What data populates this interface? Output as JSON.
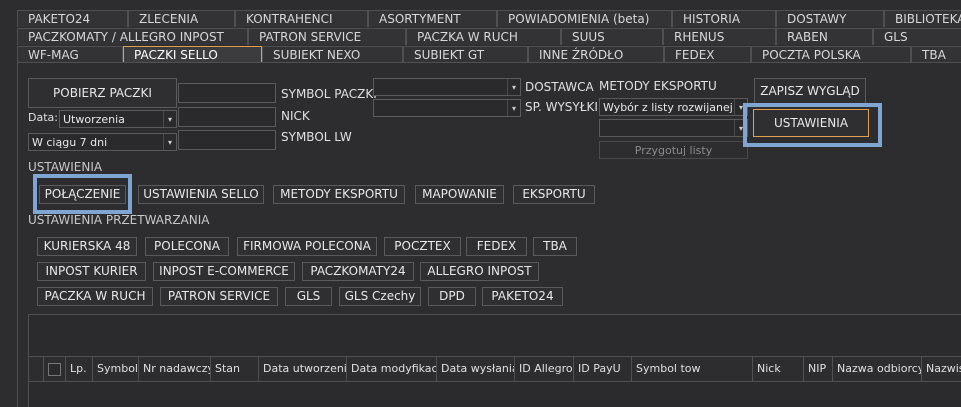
{
  "tabs_row1": [
    "PAKETO24",
    "ZLECENIA",
    "KONTRAHENCI",
    "ASORTYMENT",
    "POWIADOMIENIA (beta)",
    "HISTORIA",
    "DOSTAWY",
    "BIBLIOTEKA"
  ],
  "tabs_row2": [
    "PACZKOMATY / ALLEGRO INPOST",
    "PATRON SERVICE",
    "PACZKA W RUCH",
    "SUUS",
    "RHENUS",
    "RABEN",
    "GLS"
  ],
  "tabs_row3": [
    "WF-MAG",
    "PACZKI SELLO",
    "SUBIEKT NEXO",
    "SUBIEKT GT",
    "INNE ŹRÓDŁO",
    "FEDEX",
    "POCZTA POLSKA",
    "TBA"
  ],
  "active_tab": "PACZKI SELLO",
  "form": {
    "pobierz_label": "POBIERZ PACZKI",
    "data_label": "Data:",
    "data_value": "Utworzenia",
    "period_value": "W ciągu 7 dni",
    "symbol_paczki_label": "SYMBOL PACZKI",
    "nick_label": "NICK",
    "symbol_lw_label": "SYMBOL LW",
    "dostawca_label": "DOSTAWCA",
    "sp_wysylki_label": "SP. WYSYŁKI",
    "metody_eksportu_label": "METODY EKSPORTU",
    "metody_value": "Wybór z listy rozwijanej",
    "przygotuj_label": "Przygotuj listy",
    "zapisz_label": "ZAPISZ WYGLĄD",
    "ustawienia_btn_label": "USTAWIENIA"
  },
  "settings": {
    "section_label": "USTAWIENIA",
    "buttons": [
      "POŁĄCZENIE",
      "USTAWIENIA SELLO",
      "METODY EKSPORTU",
      "MAPOWANIE",
      "EKSPORTU"
    ]
  },
  "processing": {
    "section_label": "USTAWIENIA PRZETWARZANIA",
    "row1": [
      "KURIERSKA 48",
      "POLECONA",
      "FIRMOWA POLECONA",
      "POCZTEX",
      "FEDEX",
      "TBA"
    ],
    "row2": [
      "INPOST KURIER",
      "INPOST E-COMMERCE",
      "PACZKOMATY24",
      "ALLEGRO INPOST"
    ],
    "row3": [
      "PACZKA W RUCH",
      "PATRON SERVICE",
      "GLS",
      "GLS Czechy",
      "DPD",
      "PAKETO24"
    ]
  },
  "grid": {
    "columns": [
      "Lp.",
      "Symbol",
      "Nr nadawczy",
      "Stan",
      "Data utworzenia",
      "Data modyfikacji",
      "Data wysłania",
      "ID Allegro",
      "ID PayU",
      "Symbol tow",
      "Nick",
      "NIP",
      "Nazwa odbiorcy",
      "Nazwis"
    ]
  }
}
